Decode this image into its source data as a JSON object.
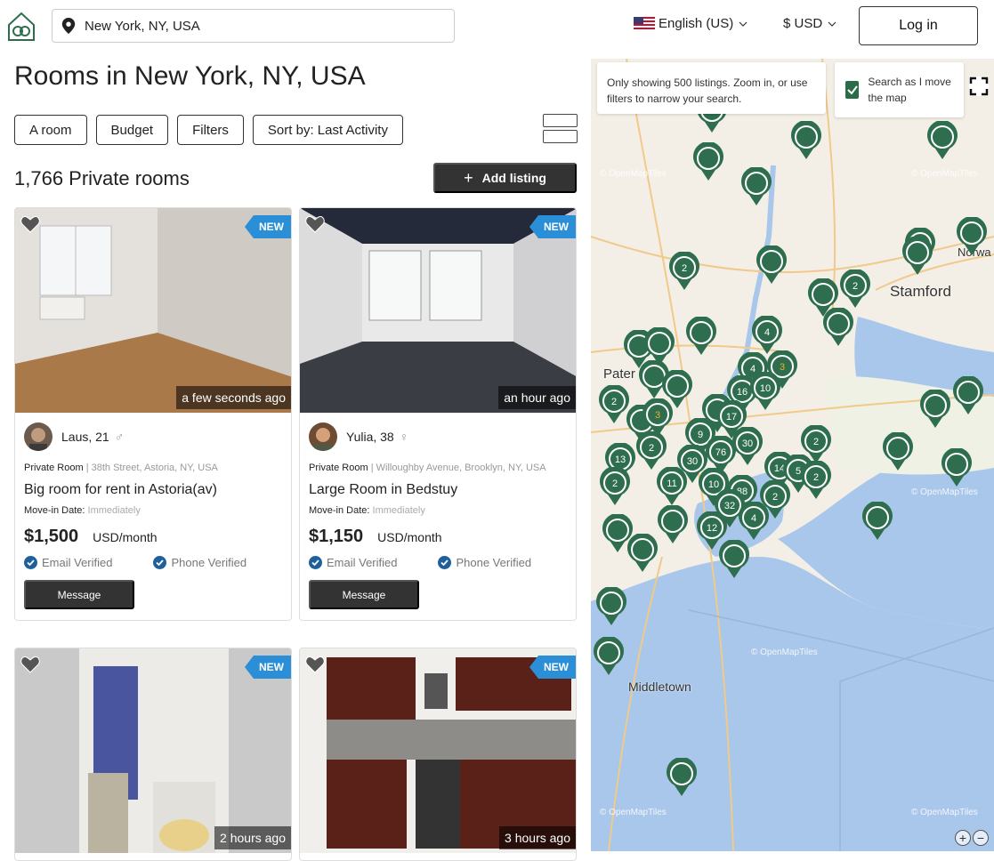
{
  "header": {
    "location": "New York, NY, USA",
    "language": "English (US)",
    "currency": "$ USD",
    "login_label": "Log in"
  },
  "main": {
    "title": "Rooms in New York, NY, USA",
    "filters": [
      "A room",
      "Budget",
      "Filters",
      "Sort by: Last Activity"
    ],
    "count": "1,766 Private rooms",
    "add_listing_label": "Add listing"
  },
  "listings": [
    {
      "new_badge": "NEW",
      "time": "a few seconds ago",
      "user": "Laus, 21",
      "gender": "♂",
      "room_type": "Private Room",
      "address": "38th Street, Astoria, NY, USA",
      "title": "Big room for rent in Astoria(av)",
      "move_in_label": "Move-in Date:",
      "move_in": "Immediately",
      "price": "$1,500",
      "price_unit": "USD/month",
      "email_verified": "Email Verified",
      "phone_verified": "Phone Verified",
      "message_label": "Message"
    },
    {
      "new_badge": "NEW",
      "time": "an hour ago",
      "user": "Yulia, 38",
      "gender": "♀",
      "room_type": "Private Room",
      "address": "Willoughby Avenue, Brooklyn, NY, USA",
      "title": "Large Room in Bedstuy",
      "move_in_label": "Move-in Date:",
      "move_in": "Immediately",
      "price": "$1,150",
      "price_unit": "USD/month",
      "email_verified": "Email Verified",
      "phone_verified": "Phone Verified",
      "message_label": "Message"
    },
    {
      "new_badge": "NEW",
      "time": "2 hours ago"
    },
    {
      "new_badge": "NEW",
      "time": "3 hours ago"
    }
  ],
  "map": {
    "notice": "Only showing 500 listings. Zoom in, or use filters to narrow your search.",
    "search_as_move": "Search as I move the map",
    "places": {
      "stamford": "Stamford",
      "norwalk": "Norwa",
      "paterson": "Pater",
      "middletown": "Middletown"
    },
    "watermark": "© OpenMapTiles",
    "zoom_in": "+",
    "zoom_out": "−",
    "clusters": [
      "2",
      "2",
      "4",
      "4",
      "3",
      "16",
      "10",
      "2",
      "3",
      "9",
      "17",
      "30",
      "76",
      "2",
      "13",
      "2",
      "30",
      "11",
      "10",
      "88",
      "14",
      "5",
      "2",
      "2",
      "2",
      "32",
      "4",
      "12"
    ],
    "colors": {
      "marker": "#2e6e4e",
      "accent_blue": "#2b8fd8"
    }
  }
}
